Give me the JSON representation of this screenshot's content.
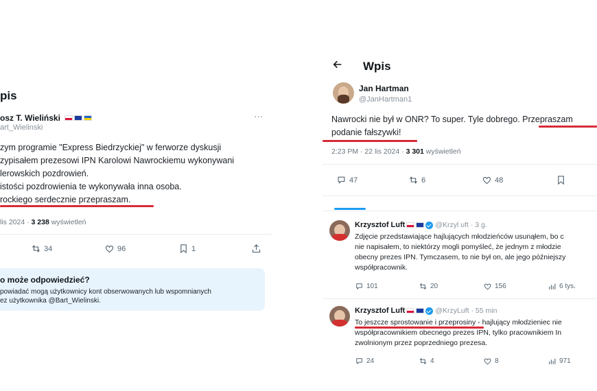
{
  "left": {
    "header_title": "pis",
    "author": {
      "name": "osz T. Wieliński",
      "handle": "art_Wielinski"
    },
    "more_label": "···",
    "body_lines": [
      "zym programie \"Express Biedrzyckiej\" w ferworze dyskusji",
      "zypisałem prezesowi IPN Karolowi Nawrockiemu wykonywani",
      "lerowskich pozdrowień.",
      "istości pozdrowienia te wykonywała inna osoba.",
      "rockiego serdecznie przepraszam."
    ],
    "meta": {
      "date": "lis 2024 · ",
      "views_count": "3 238",
      "views_label": " wyświetleń"
    },
    "actions": {
      "retweets": "34",
      "likes": "96",
      "bookmarks": "1"
    },
    "reply_box": {
      "title": "o może odpowiedzieć?",
      "line1": "powiadać mogą użytkownicy kont obserwowanych lub wspomnianych",
      "line2": "ez użytkownika @Bart_Wielinski."
    }
  },
  "right": {
    "back_icon": "arrow-left-icon",
    "header_title": "Wpis",
    "author": {
      "name": "Jan Hartman",
      "handle": "@JanHartman1"
    },
    "body_line1": "Nawrocki nie był w ONR? To super. Tyle dobrego. Przepraszam",
    "body_line2": "podanie fałszywki!",
    "meta": {
      "date": "2:23 PM · 22 lis 2024 · ",
      "views_count": "3 301",
      "views_label": " wyświetleń"
    },
    "actions": {
      "replies": "47",
      "retweets": "6",
      "likes": "48"
    },
    "replies": [
      {
        "name": "Krzysztof Luft",
        "handle_time": "@Krzyl uft · 3 g.",
        "lines": [
          "Zdjęcie przedstawiające hajlujących młodzieńców usunąłem, bo c",
          "nie napisałem, to niektórzy mogli pomyśleć, że jednym z młodzie",
          "obecny prezes IPN. Tymczasem, to nie był on, ale jego późniejszy",
          "współpracownik."
        ],
        "actions": {
          "replies": "101",
          "retweets": "20",
          "likes": "156",
          "views": "6 tys."
        }
      },
      {
        "name": "Krzysztof Luft",
        "handle_time": "@KrzyLuft · 55 min",
        "lines": [
          "To jeszcze sprostowanie i przeprosiny - hajlujący młodzieniec nie",
          "współpracownikiem obecnego prezes IPN, tylko pracownikiem In",
          "zwolnionym przez poprzedniego prezesa."
        ],
        "actions": {
          "replies": "24",
          "retweets": "4",
          "likes": "8",
          "views": "971"
        }
      }
    ]
  },
  "colors": {
    "underline": "#d62b36",
    "accent": "#1d9bf0",
    "reply_box_bg": "#e8f4fd"
  }
}
